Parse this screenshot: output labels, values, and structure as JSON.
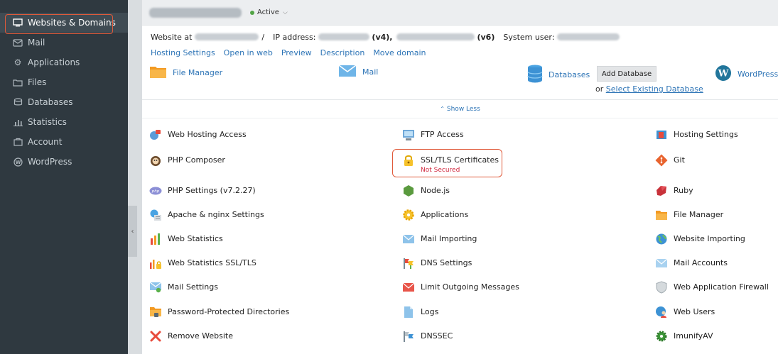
{
  "sidebar": {
    "items": [
      {
        "label": "Websites & Domains",
        "icon": "monitor-icon",
        "active": true
      },
      {
        "label": "Mail",
        "icon": "envelope-icon"
      },
      {
        "label": "Applications",
        "icon": "gear-icon"
      },
      {
        "label": "Files",
        "icon": "folder-icon"
      },
      {
        "label": "Databases",
        "icon": "database-icon"
      },
      {
        "label": "Statistics",
        "icon": "bar-chart-icon"
      },
      {
        "label": "Account",
        "icon": "account-icon"
      },
      {
        "label": "WordPress",
        "icon": "wordpress-icon"
      }
    ],
    "collapse_glyph": "‹"
  },
  "domain": {
    "status": "Active"
  },
  "info": {
    "website_at_label": "Website at",
    "website_slash": "/",
    "ip_label": "IP address:",
    "v4_suffix": "(v4),",
    "v6_suffix": "(v6)",
    "system_user_label": "System user:"
  },
  "links": [
    "Hosting Settings",
    "Open in web",
    "Preview",
    "Description",
    "Move domain"
  ],
  "quick": {
    "file_manager": "File Manager",
    "mail": "Mail",
    "databases": "Databases",
    "add_database": "Add Database",
    "or_text": "or",
    "select_existing": "Select Existing Database",
    "wordpress": "WordPress"
  },
  "show_less": "Show Less",
  "tools": [
    {
      "label": "Web Hosting Access",
      "icon": "hosting-access-icon"
    },
    {
      "label": "FTP Access",
      "icon": "ftp-icon"
    },
    {
      "label": "Hosting Settings",
      "icon": "hosting-settings-icon"
    },
    {
      "label": "PHP Composer",
      "icon": "composer-icon"
    },
    {
      "label": "SSL/TLS Certificates",
      "sub": "Not Secured",
      "icon": "lock-icon"
    },
    {
      "label": "Git",
      "icon": "git-icon"
    },
    {
      "label": "PHP Settings (v7.2.27)",
      "icon": "php-icon"
    },
    {
      "label": "Node.js",
      "icon": "nodejs-icon"
    },
    {
      "label": "Ruby",
      "icon": "ruby-icon"
    },
    {
      "label": "Apache & nginx Settings",
      "icon": "server-settings-icon"
    },
    {
      "label": "Applications",
      "icon": "applications-gear-icon"
    },
    {
      "label": "File Manager",
      "icon": "folder-icon"
    },
    {
      "label": "Web Statistics",
      "icon": "bar-chart-icon"
    },
    {
      "label": "Mail Importing",
      "icon": "mail-import-icon"
    },
    {
      "label": "Website Importing",
      "icon": "globe-icon"
    },
    {
      "label": "Web Statistics SSL/TLS",
      "icon": "stats-lock-icon"
    },
    {
      "label": "DNS Settings",
      "icon": "dns-icon"
    },
    {
      "label": "Mail Accounts",
      "icon": "mail-accounts-icon"
    },
    {
      "label": "Mail Settings",
      "icon": "mail-settings-icon"
    },
    {
      "label": "Limit Outgoing Messages",
      "icon": "mail-limit-icon"
    },
    {
      "label": "Web Application Firewall",
      "icon": "shield-icon"
    },
    {
      "label": "Password-Protected Directories",
      "icon": "protected-folder-icon"
    },
    {
      "label": "Logs",
      "icon": "logs-icon"
    },
    {
      "label": "Web Users",
      "icon": "users-icon"
    },
    {
      "label": "Remove Website",
      "icon": "remove-icon"
    },
    {
      "label": "DNSSEC",
      "icon": "dnssec-icon"
    },
    {
      "label": "ImunifyAV",
      "icon": "imunify-icon"
    }
  ]
}
